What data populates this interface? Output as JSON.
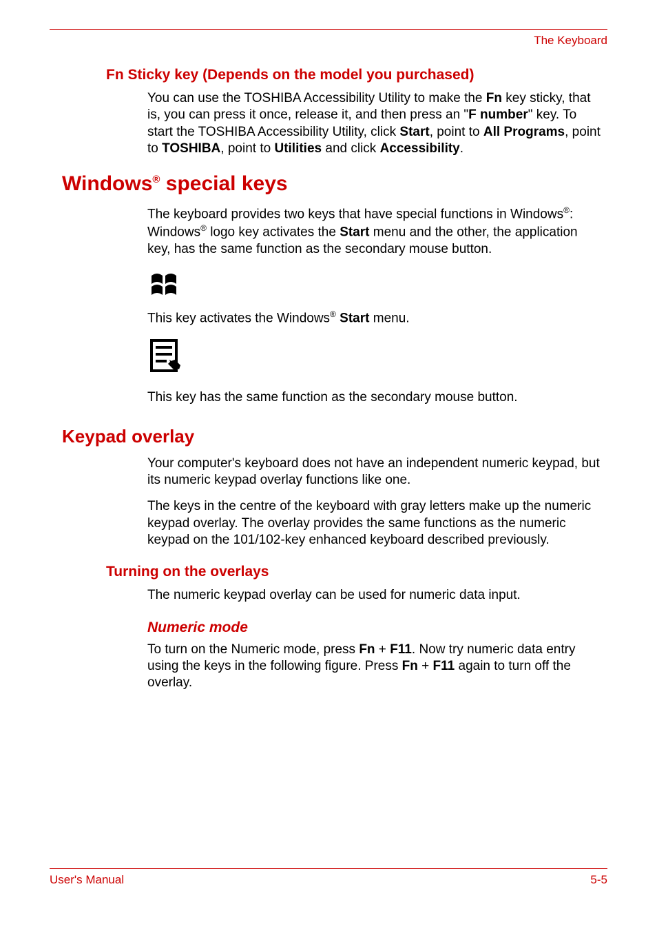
{
  "header": {
    "right_text": "The Keyboard"
  },
  "section1": {
    "heading": "Fn Sticky key (Depends on the model you purchased)",
    "p1_part1": "You can use the TOSHIBA Accessibility Utility to make the ",
    "p1_fn": "Fn",
    "p1_part2": " key sticky, that is, you can press it once, release it, and then press an \"",
    "p1_fnumber": "F number",
    "p1_part3": "\" key. To start the TOSHIBA Accessibility Utility, click ",
    "p1_start": "Start",
    "p1_part4": ", point to ",
    "p1_allprograms": "All Programs",
    "p1_part5": ", point to ",
    "p1_toshiba": "TOSHIBA",
    "p1_part6": ", point to ",
    "p1_utilities": "Utilities",
    "p1_part7": " and click ",
    "p1_accessibility": "Accessibility",
    "p1_part8": "."
  },
  "section2": {
    "heading_part1": "Windows",
    "heading_sup": "®",
    "heading_part2": " special keys",
    "p1_part1": "The keyboard provides two keys that have special functions in Windows",
    "p1_sup1": "®",
    "p1_part2": ": Windows",
    "p1_sup2": "®",
    "p1_part3": " logo key activates the ",
    "p1_start": "Start",
    "p1_part4": " menu and the other, the application key, has the same function as the secondary mouse button.",
    "p2_part1": "This key activates the Windows",
    "p2_sup": "®",
    "p2_space": " ",
    "p2_start": "Start",
    "p2_part2": " menu.",
    "p3": "This key has the same function as the secondary mouse button."
  },
  "section3": {
    "heading": "Keypad overlay",
    "p1": "Your computer's keyboard does not have an independent numeric keypad, but its numeric keypad overlay functions like one.",
    "p2": "The keys in the centre of the keyboard with gray letters make up the numeric keypad overlay. The overlay provides the same functions as the numeric keypad on the 101/102-key enhanced keyboard described previously."
  },
  "section4": {
    "heading": "Turning on the overlays",
    "p1": "The numeric keypad overlay can be used for numeric data input."
  },
  "section5": {
    "heading": "Numeric mode",
    "p1_part1": "To turn on the Numeric mode, press ",
    "p1_fn1": "Fn",
    "p1_part2": " + ",
    "p1_f11a": "F11",
    "p1_part3": ". Now try numeric data entry using the keys in the following figure. Press ",
    "p1_fn2": "Fn",
    "p1_part4": " + ",
    "p1_f11b": "F11",
    "p1_part5": " again to turn off the overlay."
  },
  "footer": {
    "left": "User's Manual",
    "right": "5-5"
  }
}
